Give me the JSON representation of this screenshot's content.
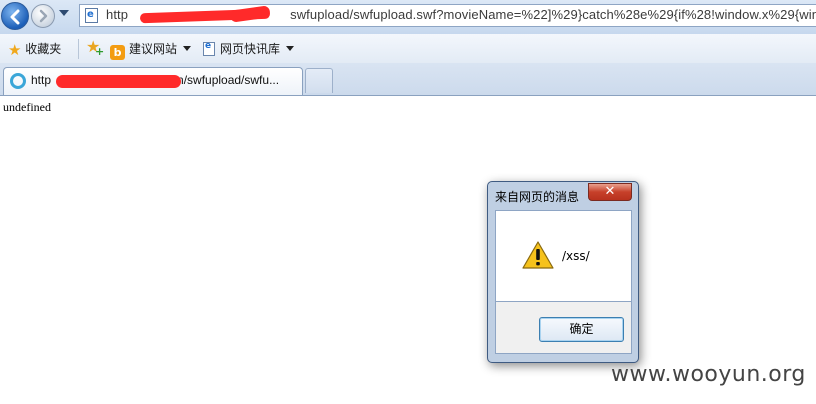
{
  "browser": {
    "address_bar": {
      "url_prefix": "http",
      "url_middle": "swfupload/swfupload.swf?movieName=%22]%29}catch%28e%29{if%28!window.x%29{window.",
      "redaction_color": "#ff2a2a"
    },
    "favorites_bar": {
      "favorites_label": "收藏夹",
      "suggested_sites_label": "建议网站",
      "web_slice_gallery_label": "网页快讯库"
    },
    "tabs": [
      {
        "title_prefix": "http",
        "title_suffix": "cn/swfupload/swfu..."
      }
    ],
    "page": {
      "body_text": "undefined"
    }
  },
  "dialog": {
    "title": "来自网页的消息",
    "close_glyph": "✕",
    "icon": "warning-icon",
    "message": "/xss/",
    "ok_label": "确定"
  },
  "watermark": {
    "text": "www.wooyun.org"
  }
}
